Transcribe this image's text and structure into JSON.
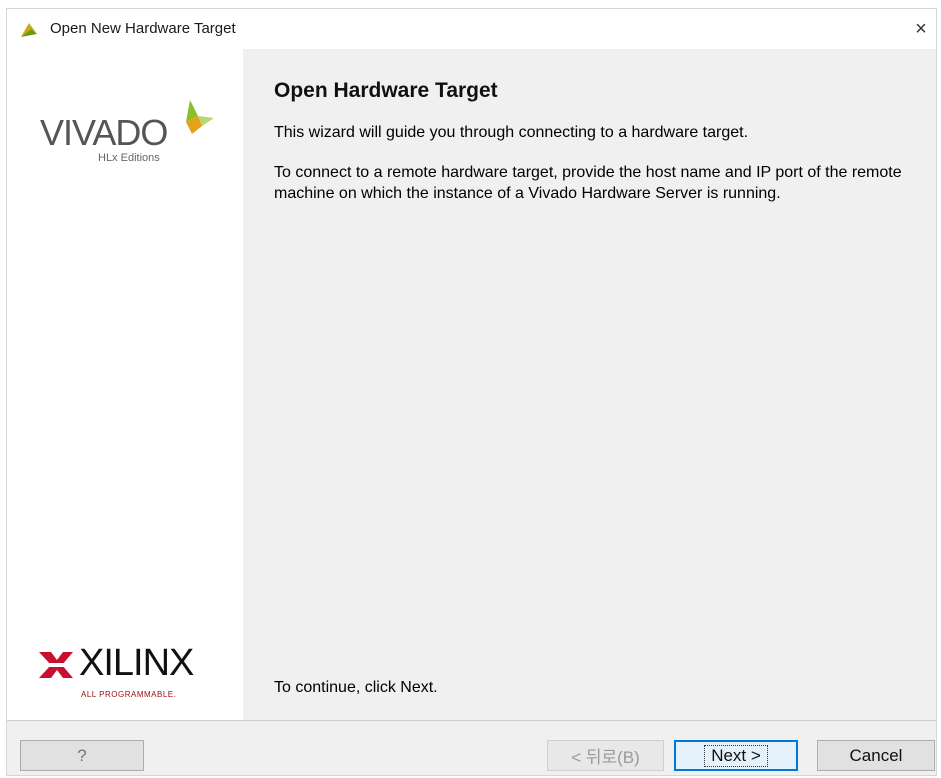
{
  "window": {
    "title": "Open New Hardware Target",
    "close_glyph": "×"
  },
  "sidebar": {
    "vivado_word": "VIVADO",
    "vivado_sub": "HLx Editions",
    "xilinx_word": "XILINX",
    "xilinx_sub": "ALL PROGRAMMABLE."
  },
  "content": {
    "heading": "Open Hardware Target",
    "para1": "This wizard will guide you through connecting to a hardware target.",
    "para2": "To connect to a remote hardware target, provide the host name and IP port of the remote machine on which the instance of a Vivado Hardware Server is running.",
    "continue_text": "To continue, click Next."
  },
  "buttons": {
    "help": "?",
    "back": "< 뒤로(B)",
    "next": "Next >",
    "cancel": "Cancel"
  },
  "colors": {
    "accent_border": "#0078d7",
    "vivado_leaf": "#8cbf26",
    "xilinx_red": "#c8102e"
  }
}
